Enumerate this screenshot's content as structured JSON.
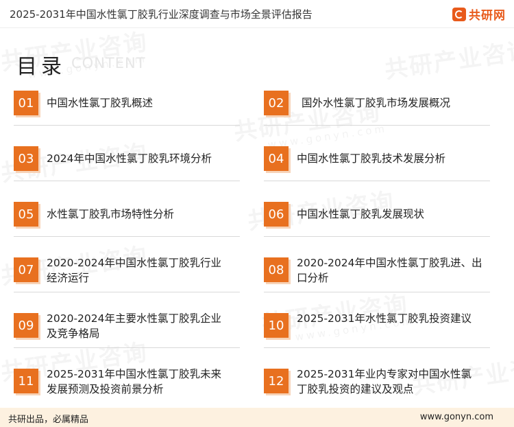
{
  "header": {
    "title": "2025-2031年中国水性氯丁胶乳行业深度调查与市场全景评估报告",
    "logo_text": "共研网"
  },
  "watermark": {
    "text": "共研产业咨询",
    "sub": "www.gonyn.com"
  },
  "section": {
    "title": "目录",
    "subtitle": "CONTENT"
  },
  "toc": [
    {
      "num": "01",
      "label": "中国水性氯丁胶乳概述"
    },
    {
      "num": "02",
      "label": "国外水性氯丁胶乳市场发展概况"
    },
    {
      "num": "03",
      "label": "2024年中国水性氯丁胶乳环境分析"
    },
    {
      "num": "04",
      "label": "中国水性氯丁胶乳技术发展分析"
    },
    {
      "num": "05",
      "label": "水性氯丁胶乳市场特性分析"
    },
    {
      "num": "06",
      "label": "中国水性氯丁胶乳发展现状"
    },
    {
      "num": "07",
      "label": "2020-2024年中国水性氯丁胶乳行业经济运行"
    },
    {
      "num": "08",
      "label": "2020-2024年中国水性氯丁胶乳进、出口分析"
    },
    {
      "num": "09",
      "label": "2020-2024年主要水性氯丁胶乳企业及竞争格局"
    },
    {
      "num": "10",
      "label": "2025-2031年水性氯丁胶乳投资建议"
    },
    {
      "num": "11",
      "label": "2025-2031年中国水性氯丁胶乳未来发展预测及投资前景分析"
    },
    {
      "num": "12",
      "label": "2025-2031年业内专家对中国水性氯丁胶乳投资的建议及观点"
    }
  ],
  "footer": {
    "left": "共研出品，必属精品",
    "right": "www.gonyn.com"
  },
  "colors": {
    "accent": "#e8701f",
    "footer_bg": "#fdf1e0"
  }
}
